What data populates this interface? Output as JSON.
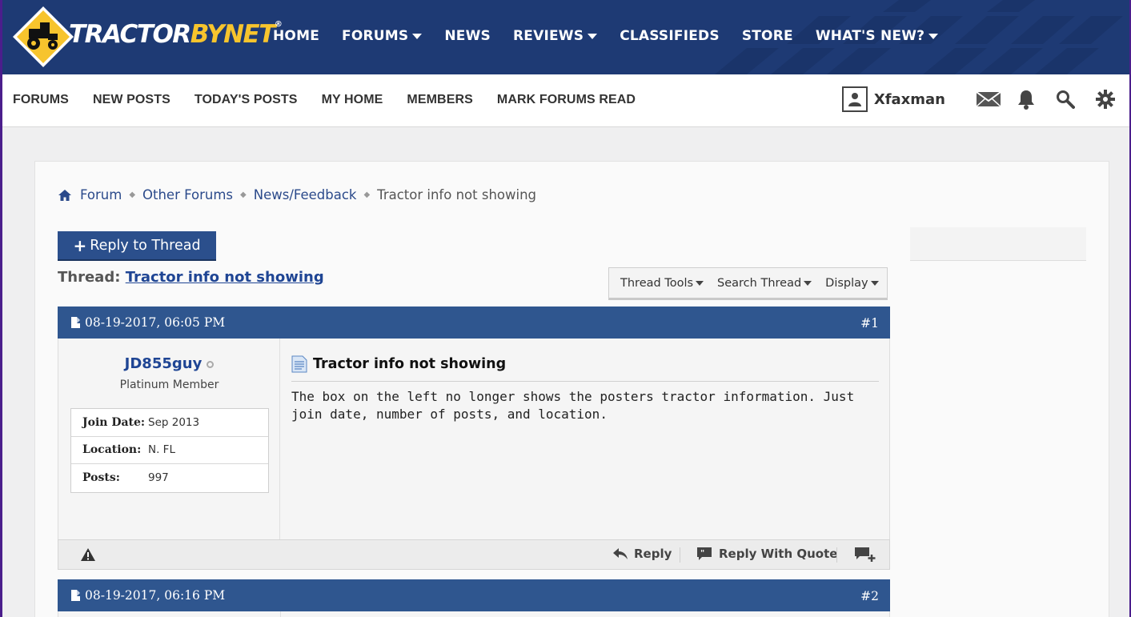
{
  "header": {
    "logo_primary": "TRACTOR",
    "logo_secondary": "BYNET",
    "logo_mark": "®",
    "nav": [
      {
        "label": "HOME",
        "dropdown": false
      },
      {
        "label": "FORUMS",
        "dropdown": true
      },
      {
        "label": "NEWS",
        "dropdown": false
      },
      {
        "label": "REVIEWS",
        "dropdown": true
      },
      {
        "label": "CLASSIFIEDS",
        "dropdown": false
      },
      {
        "label": "STORE",
        "dropdown": false
      },
      {
        "label": "WHAT'S NEW?",
        "dropdown": true
      }
    ],
    "colors": {
      "bar": "#1e3a74",
      "accent": "#f7c42d"
    }
  },
  "subnav": {
    "links": [
      "FORUMS",
      "NEW POSTS",
      "TODAY'S POSTS",
      "MY HOME",
      "MEMBERS",
      "MARK FORUMS READ"
    ],
    "username": "Xfaxman",
    "icons": [
      "user-icon",
      "mail-icon",
      "bell-icon",
      "search-icon",
      "gear-icon"
    ]
  },
  "breadcrumb": {
    "items": [
      "Forum",
      "Other Forums",
      "News/Feedback"
    ],
    "current": "Tractor info not showing"
  },
  "thread": {
    "reply_button": "Reply to Thread",
    "reply_plus": "+",
    "title_prefix": "Thread:",
    "title": "Tractor info not showing",
    "tools": [
      "Thread Tools",
      "Search Thread",
      "Display"
    ]
  },
  "posts": [
    {
      "date": "08-19-2017, 06:05 PM",
      "number": "#1",
      "username": "JD855guy",
      "user_title": "Platinum Member",
      "info": [
        {
          "label": "Join Date:",
          "value": "Sep 2013"
        },
        {
          "label": "Location:",
          "value": "N. FL"
        },
        {
          "label": "Posts:",
          "value": "997"
        }
      ],
      "title": "Tractor info not showing",
      "message": "The box on the left no longer shows the posters tractor information. Just join date, number of posts, and location.",
      "actions": {
        "reply": "Reply",
        "quote": "Reply With Quote"
      }
    },
    {
      "date": "08-19-2017, 06:16 PM",
      "number": "#2"
    }
  ]
}
